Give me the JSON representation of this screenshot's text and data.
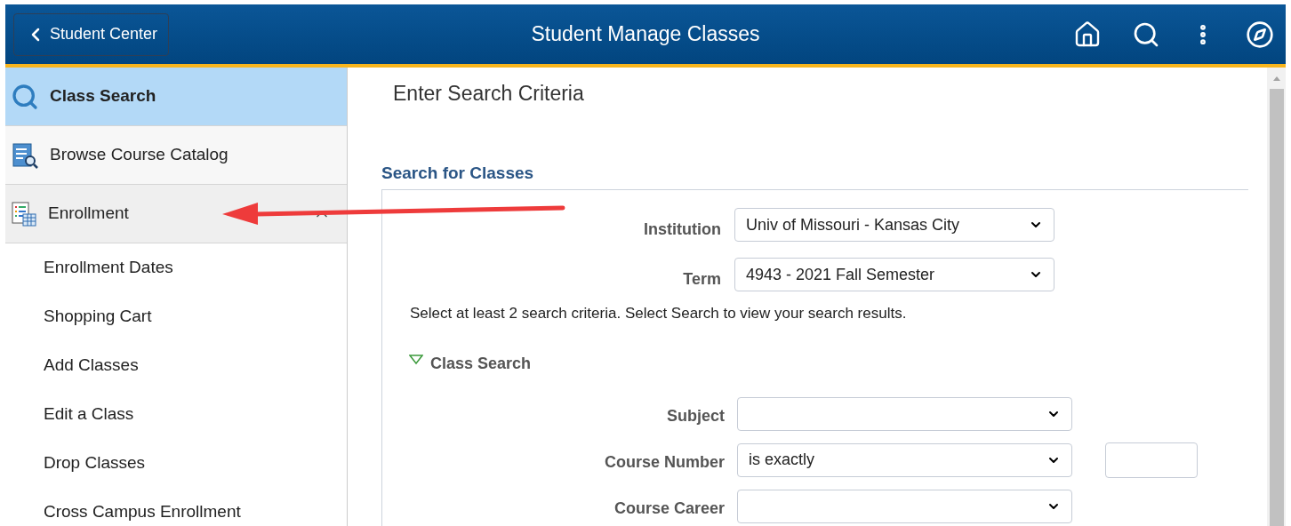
{
  "header": {
    "back_button": "Student Center",
    "title": "Student Manage Classes"
  },
  "sidebar": {
    "items": [
      {
        "kind": "search",
        "label": "Class Search",
        "selected": true
      },
      {
        "kind": "catalog",
        "label": "Browse Course Catalog",
        "selected": false
      },
      {
        "kind": "enrollment",
        "label": "Enrollment",
        "selected": false,
        "expanded": true,
        "children": [
          {
            "label": "Enrollment Dates",
            "selected": false
          },
          {
            "label": "Shopping Cart",
            "selected": false
          },
          {
            "label": "Add Classes",
            "selected": false
          },
          {
            "label": "Edit a Class",
            "selected": false
          },
          {
            "label": "Drop Classes",
            "selected": false
          },
          {
            "label": "Cross Campus Enrollment",
            "selected": false
          }
        ]
      }
    ]
  },
  "content": {
    "heading": "Enter Search Criteria",
    "section_title": "Search for Classes",
    "top_fields": [
      {
        "label": "Institution",
        "value": "Univ of Missouri - Kansas City"
      },
      {
        "label": "Term",
        "value": "4943 - 2021 Fall Semester"
      }
    ],
    "instruction": "Select at least 2 search criteria. Select Search to view your search results.",
    "group": {
      "title": "Class Search",
      "expanded": true,
      "fields": [
        {
          "kind": "select",
          "label": "Subject"
        },
        {
          "kind": "select_with_input",
          "label": "Course Number",
          "value": "is exactly"
        },
        {
          "kind": "select",
          "label": "Course Career"
        }
      ]
    }
  }
}
